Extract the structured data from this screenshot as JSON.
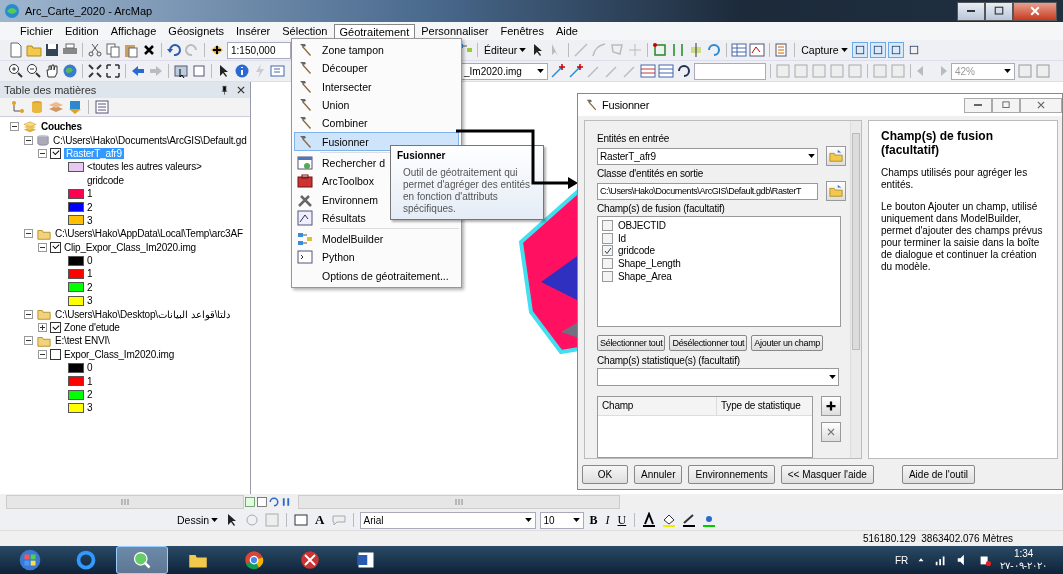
{
  "window": {
    "title": "Arc_Carte_2020 - ArcMap"
  },
  "menu_bar": [
    {
      "label": "Fichier",
      "selected": false
    },
    {
      "label": "Edition",
      "selected": false
    },
    {
      "label": "Affichage",
      "selected": false
    },
    {
      "label": "Géosignets",
      "selected": false
    },
    {
      "label": "Insérer",
      "selected": false
    },
    {
      "label": "Sélection",
      "selected": false
    },
    {
      "label": "Géotraitement",
      "selected": true
    },
    {
      "label": "Personnaliser",
      "selected": false
    },
    {
      "label": "Fenêtres",
      "selected": false
    },
    {
      "label": "Aide",
      "selected": false
    }
  ],
  "toolbar": {
    "scale": "1:150,000",
    "editor": "Éditeur",
    "capture": "Capture",
    "layer_dropdown": "_Im2020.img",
    "zoom": "42%",
    "snap_buttons": [
      {
        "selected": true
      },
      {
        "selected": true
      },
      {
        "selected": true
      },
      {
        "selected": false
      }
    ]
  },
  "geoprocessing_menu": [
    {
      "label": "Zone tampon",
      "kind": "hammer",
      "selected": false,
      "separator_after": false
    },
    {
      "label": "Découper",
      "kind": "hammer",
      "selected": false,
      "separator_after": false
    },
    {
      "label": "Intersecter",
      "kind": "hammer",
      "selected": false,
      "separator_after": false
    },
    {
      "label": "Union",
      "kind": "hammer",
      "selected": false,
      "separator_after": false
    },
    {
      "label": "Combiner",
      "kind": "hammer",
      "selected": false,
      "separator_after": false
    },
    {
      "label": "Fusionner",
      "kind": "hammer",
      "selected": true,
      "separator_after": true
    },
    {
      "label": "Rechercher d",
      "kind": "search",
      "selected": false,
      "separator_after": false
    },
    {
      "label": "ArcToolbox",
      "kind": "toolbox",
      "selected": false,
      "separator_after": false
    },
    {
      "label": "Environnem",
      "kind": "tools",
      "selected": false,
      "separator_after": false
    },
    {
      "label": "Résultats",
      "kind": "results",
      "selected": false,
      "separator_after": true
    },
    {
      "label": "ModelBuilder",
      "kind": "model",
      "selected": false,
      "separator_after": false
    },
    {
      "label": "Python",
      "kind": "python",
      "selected": false,
      "separator_after": false
    },
    {
      "label": "Options de géotraitement...",
      "kind": "none",
      "selected": false,
      "separator_after": false
    }
  ],
  "tooltip": {
    "title": "Fusionner",
    "text": "Outil de géotraitement qui permet d'agréger des entités en fonction d'attributs spécifiques."
  },
  "toc": {
    "title": "Table des matières",
    "tree": [
      {
        "label": "Couches",
        "kind": "group",
        "expanded": true,
        "children": [
          {
            "label": "C:\\Users\\Hako\\Documents\\ArcGIS\\Default.gd",
            "kind": "database",
            "expanded": true,
            "children": [
              {
                "label": "RasterT_afr9",
                "kind": "layer",
                "checked": true,
                "selected": true,
                "expanded": true,
                "children": [
                  {
                    "label": "<toutes les autres valeurs>",
                    "kind": "legend",
                    "color": "#e8c8f0"
                  },
                  {
                    "label": "gridcode",
                    "kind": "heading"
                  },
                  {
                    "label": "1",
                    "kind": "legend",
                    "color": "#ff0050"
                  },
                  {
                    "label": "2",
                    "kind": "legend",
                    "color": "#0000ff"
                  },
                  {
                    "label": "3",
                    "kind": "legend",
                    "color": "#ffc000"
                  }
                ]
              }
            ]
          },
          {
            "label": "C:\\Users\\Hako\\AppData\\Local\\Temp\\arc3AF",
            "kind": "folder",
            "expanded": true,
            "children": [
              {
                "label": "Clip_Expor_Class_Im2020.img",
                "kind": "layer",
                "checked": true,
                "selected": false,
                "expanded": true,
                "children": [
                  {
                    "label": "0",
                    "kind": "legend",
                    "color": "#000000"
                  },
                  {
                    "label": "1",
                    "kind": "legend",
                    "color": "#ff0000"
                  },
                  {
                    "label": "2",
                    "kind": "legend",
                    "color": "#00ff00"
                  },
                  {
                    "label": "3",
                    "kind": "legend",
                    "color": "#ffff00"
                  }
                ]
              }
            ]
          },
          {
            "label": "C:\\Users\\Hako\\Desktop\\دلتا\\قواعد البيانات",
            "kind": "folder",
            "expanded": true,
            "children": [
              {
                "label": "Zone d'etude",
                "kind": "layer",
                "checked": true,
                "selected": false,
                "expanded": false
              }
            ]
          },
          {
            "label": "E:\\test ENVI\\",
            "kind": "folder",
            "expanded": true,
            "children": [
              {
                "label": "Expor_Class_Im2020.img",
                "kind": "layer",
                "checked": false,
                "selected": false,
                "expanded": true,
                "children": [
                  {
                    "label": "0",
                    "kind": "legend",
                    "color": "#000000"
                  },
                  {
                    "label": "1",
                    "kind": "legend",
                    "color": "#ff0000"
                  },
                  {
                    "label": "2",
                    "kind": "legend",
                    "color": "#00ff00"
                  },
                  {
                    "label": "3",
                    "kind": "legend",
                    "color": "#ffff00"
                  }
                ]
              }
            ]
          }
        ]
      }
    ]
  },
  "dialog": {
    "title": "Fusionner",
    "input_label": "Entités en entrée",
    "input_value": "RasterT_afr9",
    "output_label": "Classe d'entités en sortie",
    "output_value": "C:\\Users\\Hako\\Documents\\ArcGIS\\Default.gdb\\RasterT",
    "dissolve_label": "Champ(s) de fusion (facultatif)",
    "dissolve_fields": [
      {
        "label": "OBJECTID",
        "checked": false
      },
      {
        "label": "Id",
        "checked": false
      },
      {
        "label": "gridcode",
        "checked": true
      },
      {
        "label": "Shape_Length",
        "checked": false
      },
      {
        "label": "Shape_Area",
        "checked": false
      }
    ],
    "list_buttons": [
      "Sélectionner tout",
      "Désélectionner tout",
      "Ajouter un champ"
    ],
    "stats_label": "Champ(s) statistique(s) (facultatif)",
    "stats_columns": [
      "Champ",
      "Type de statistique"
    ],
    "help_title": "Champ(s) de fusion (facultatif)",
    "help_paragraphs": [
      "Champs utilisés pour agréger les entités.",
      "Le bouton Ajouter un champ, utilisé uniquement dans ModelBuilder, permet d'ajouter des champs prévus pour terminer la saisie dans la boîte de dialogue et continuer la création du modèle."
    ],
    "buttons": [
      "OK",
      "Annuler",
      "Environnements",
      "<< Masquer l'aide",
      "Aide de l'outil"
    ]
  },
  "draw_toolbar": {
    "menu": "Dessin",
    "text_tool": "A",
    "font": "Arial",
    "font_size": "10",
    "format_buttons": [
      "B",
      "I",
      "U"
    ]
  },
  "status_bar": {
    "coordinates": "516180.129  3863402.076 Mètres"
  },
  "taskbar": {
    "apps": [
      {
        "kind": "browser",
        "selected": false
      },
      {
        "kind": "arcmap",
        "selected": true
      },
      {
        "kind": "explorer",
        "selected": false
      },
      {
        "kind": "chrome",
        "selected": false
      },
      {
        "kind": "snipping",
        "selected": false
      },
      {
        "kind": "word",
        "selected": false
      }
    ],
    "language": "FR",
    "time": "1:34",
    "date": "٢٠٢٠-٠٩-٢٧"
  }
}
